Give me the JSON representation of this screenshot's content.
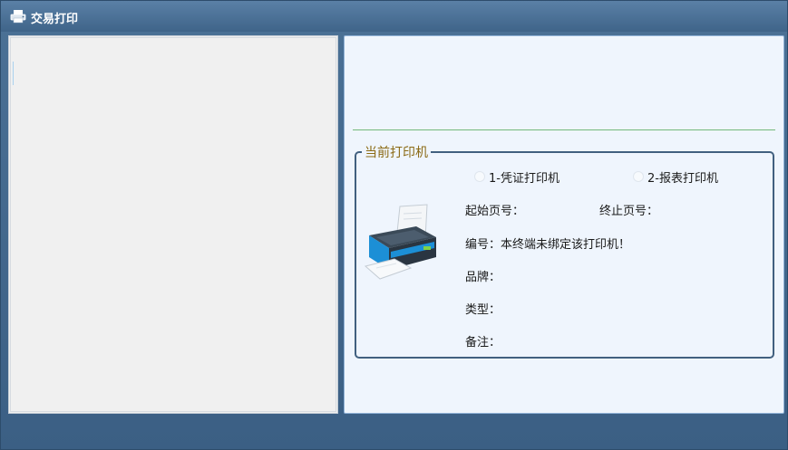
{
  "window": {
    "title": "交易打印"
  },
  "printer_group": {
    "legend": "当前打印机",
    "radios": [
      {
        "label": "1-凭证打印机"
      },
      {
        "label": "2-报表打印机"
      }
    ],
    "start_page_label": "起始页号：",
    "end_page_label": "终止页号：",
    "serial_label": "编号：",
    "serial_value": "本终端未绑定该打印机！",
    "brand_label": "品牌：",
    "type_label": "类型：",
    "remark_label": "备注："
  },
  "colors": {
    "titlebar": "#4b7196",
    "legend": "#8b6a14",
    "divider": "#74b97b",
    "group_border": "#41607f"
  },
  "icons": [
    "printer-icon",
    "print-window-icon"
  ]
}
